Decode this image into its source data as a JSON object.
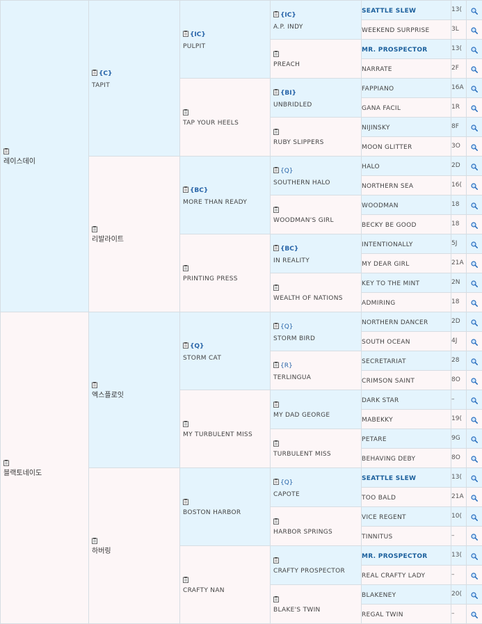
{
  "gen1": [
    {
      "name": "레이스데이"
    },
    {
      "name": "블랙토네이도"
    }
  ],
  "gen2": [
    {
      "name": "TAPIT",
      "tag": "{C}"
    },
    {
      "name": "리발라이트"
    },
    {
      "name": "엑스플로잇"
    },
    {
      "name": "하버링"
    }
  ],
  "gen3": [
    {
      "name": "PULPIT",
      "tag": "{IC}"
    },
    {
      "name": "TAP YOUR HEELS"
    },
    {
      "name": "MORE THAN READY",
      "tag": "{BC}"
    },
    {
      "name": "PRINTING PRESS"
    },
    {
      "name": "STORM CAT",
      "tag": "{Q}"
    },
    {
      "name": "MY TURBULENT MISS"
    },
    {
      "name": "BOSTON HARBOR"
    },
    {
      "name": "CRAFTY NAN"
    }
  ],
  "gen4": [
    {
      "name": "A.P. INDY",
      "tag": "{IC}"
    },
    {
      "name": "PREACH"
    },
    {
      "name": "UNBRIDLED",
      "tag": "{BI}"
    },
    {
      "name": "RUBY SLIPPERS"
    },
    {
      "name": "SOUTHERN HALO",
      "tag": "{Q}"
    },
    {
      "name": "WOODMAN'S GIRL"
    },
    {
      "name": "IN REALITY",
      "tag": "{BC}"
    },
    {
      "name": "WEALTH OF NATIONS"
    },
    {
      "name": "STORM BIRD",
      "tag": "{Q}"
    },
    {
      "name": "TERLINGUA",
      "tag": "{R}"
    },
    {
      "name": "MY DAD GEORGE"
    },
    {
      "name": "TURBULENT MISS"
    },
    {
      "name": "CAPOTE",
      "tag": "{Q}"
    },
    {
      "name": "HARBOR SPRINGS"
    },
    {
      "name": "CRAFTY PROSPECTOR"
    },
    {
      "name": "BLAKE'S TWIN"
    }
  ],
  "gen5": [
    {
      "name": "SEATTLE SLEW",
      "code": "13("
    },
    {
      "name": "WEEKEND SURPRISE",
      "code": "3L"
    },
    {
      "name": "MR. PROSPECTOR",
      "code": "13("
    },
    {
      "name": "NARRATE",
      "code": "2F"
    },
    {
      "name": "FAPPIANO",
      "code": "16A"
    },
    {
      "name": "GANA FACIL",
      "code": "1R"
    },
    {
      "name": "NIJINSKY",
      "code": "8F"
    },
    {
      "name": "MOON GLITTER",
      "code": "3O"
    },
    {
      "name": "HALO",
      "code": "2D"
    },
    {
      "name": "NORTHERN SEA",
      "code": "16("
    },
    {
      "name": "WOODMAN",
      "code": "18"
    },
    {
      "name": "BECKY BE GOOD",
      "code": "18"
    },
    {
      "name": "INTENTIONALLY",
      "code": "5J"
    },
    {
      "name": "MY DEAR GIRL",
      "code": "21A"
    },
    {
      "name": "KEY TO THE MINT",
      "code": "2N"
    },
    {
      "name": "ADMIRING",
      "code": "18"
    },
    {
      "name": "NORTHERN DANCER",
      "code": "2D"
    },
    {
      "name": "SOUTH OCEAN",
      "code": "4J"
    },
    {
      "name": "SECRETARIAT",
      "code": "28"
    },
    {
      "name": "CRIMSON SAINT",
      "code": "8O"
    },
    {
      "name": "DARK STAR",
      "code": "–"
    },
    {
      "name": "MABEKKY",
      "code": "19("
    },
    {
      "name": "PETARE",
      "code": "9G"
    },
    {
      "name": "BEHAVING DEBY",
      "code": "8O"
    },
    {
      "name": "SEATTLE SLEW",
      "code": "13("
    },
    {
      "name": "TOO BALD",
      "code": "21A"
    },
    {
      "name": "VICE REGENT",
      "code": "10("
    },
    {
      "name": "TINNITUS",
      "code": "–"
    },
    {
      "name": "MR. PROSPECTOR",
      "code": "13("
    },
    {
      "name": "REAL CRAFTY LADY",
      "code": "–"
    },
    {
      "name": "BLAKENEY",
      "code": "20("
    },
    {
      "name": "REGAL TWIN",
      "code": "–"
    }
  ],
  "icons": {
    "note": "clipboard-icon",
    "search": "magnifier-icon"
  },
  "colors": {
    "sire_bg": "#e4f4fd",
    "dam_bg": "#fdf6f7",
    "tag": "#2663a8",
    "bold_name": "#1b5f9c"
  }
}
